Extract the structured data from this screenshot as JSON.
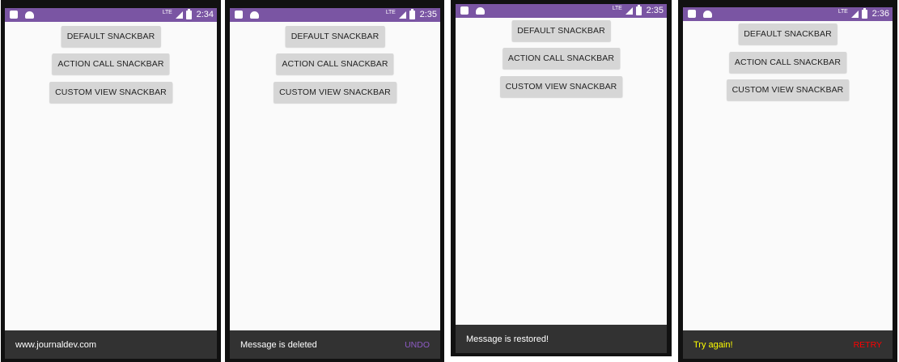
{
  "screens": [
    {
      "time": "2:34",
      "buttons": [
        "DEFAULT SNACKBAR",
        "ACTION CALL SNACKBAR",
        "CUSTOM VIEW SNACKBAR"
      ],
      "snackbar": {
        "message": "www.journaldev.com",
        "action": "",
        "message_color": "#ffffff",
        "action_color": "#ffffff"
      }
    },
    {
      "time": "2:35",
      "buttons": [
        "DEFAULT SNACKBAR",
        "ACTION CALL SNACKBAR",
        "CUSTOM VIEW SNACKBAR"
      ],
      "snackbar": {
        "message": "Message is deleted",
        "action": "UNDO",
        "message_color": "#ffffff",
        "action_color": "#8e5bc5"
      }
    },
    {
      "time": "2:35",
      "buttons": [
        "DEFAULT SNACKBAR",
        "ACTION CALL SNACKBAR",
        "CUSTOM VIEW SNACKBAR"
      ],
      "snackbar": {
        "message": "Message is restored!",
        "action": "",
        "message_color": "#ffffff",
        "action_color": "#ffffff"
      }
    },
    {
      "time": "2:36",
      "buttons": [
        "DEFAULT SNACKBAR",
        "ACTION CALL SNACKBAR",
        "CUSTOM VIEW SNACKBAR"
      ],
      "snackbar": {
        "message": "Try again!",
        "action": "RETRY",
        "message_color": "#ffff00",
        "action_color": "#ff0000"
      }
    }
  ],
  "status_bar": {
    "network_label": "LTE",
    "color": "#7a55a3"
  },
  "icons": [
    "sd-card-icon",
    "android-icon",
    "signal-icon",
    "battery-icon"
  ]
}
